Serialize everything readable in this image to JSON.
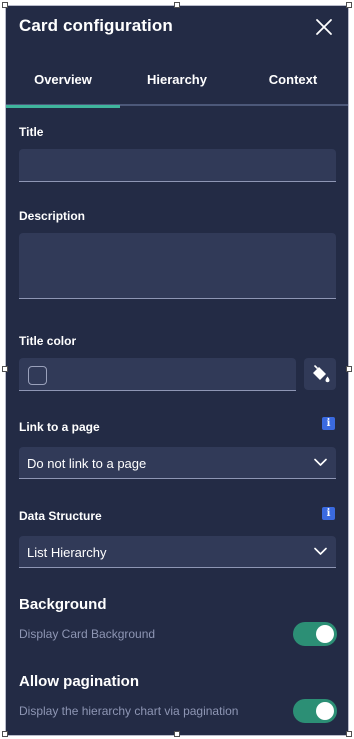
{
  "header": {
    "title": "Card configuration"
  },
  "tabs": [
    {
      "label": "Overview",
      "active": true
    },
    {
      "label": "Hierarchy",
      "active": false
    },
    {
      "label": "Context",
      "active": false
    }
  ],
  "form": {
    "title": {
      "label": "Title",
      "value": ""
    },
    "description": {
      "label": "Description",
      "value": ""
    },
    "title_color": {
      "label": "Title color",
      "value": ""
    },
    "link": {
      "label": "Link to a page",
      "info": "i",
      "selected": "Do not link to a page"
    },
    "data_structure": {
      "label": "Data Structure",
      "info": "i",
      "selected": "List Hierarchy"
    }
  },
  "background": {
    "title": "Background",
    "toggle_label": "Display Card Background",
    "enabled": true
  },
  "pagination": {
    "title": "Allow pagination",
    "toggle_label": "Display the hierarchy chart via pagination",
    "enabled": true
  },
  "colors": {
    "panel_bg": "#232b45",
    "field_bg": "#313a58",
    "accent_tab": "#3fb59c",
    "toggle_on": "#2c8f75",
    "info_badge": "#3a6ae0"
  },
  "icons": {
    "close": "close-icon",
    "chevron": "chevron-down-icon",
    "info": "info-icon",
    "fill": "paint-bucket-icon"
  }
}
